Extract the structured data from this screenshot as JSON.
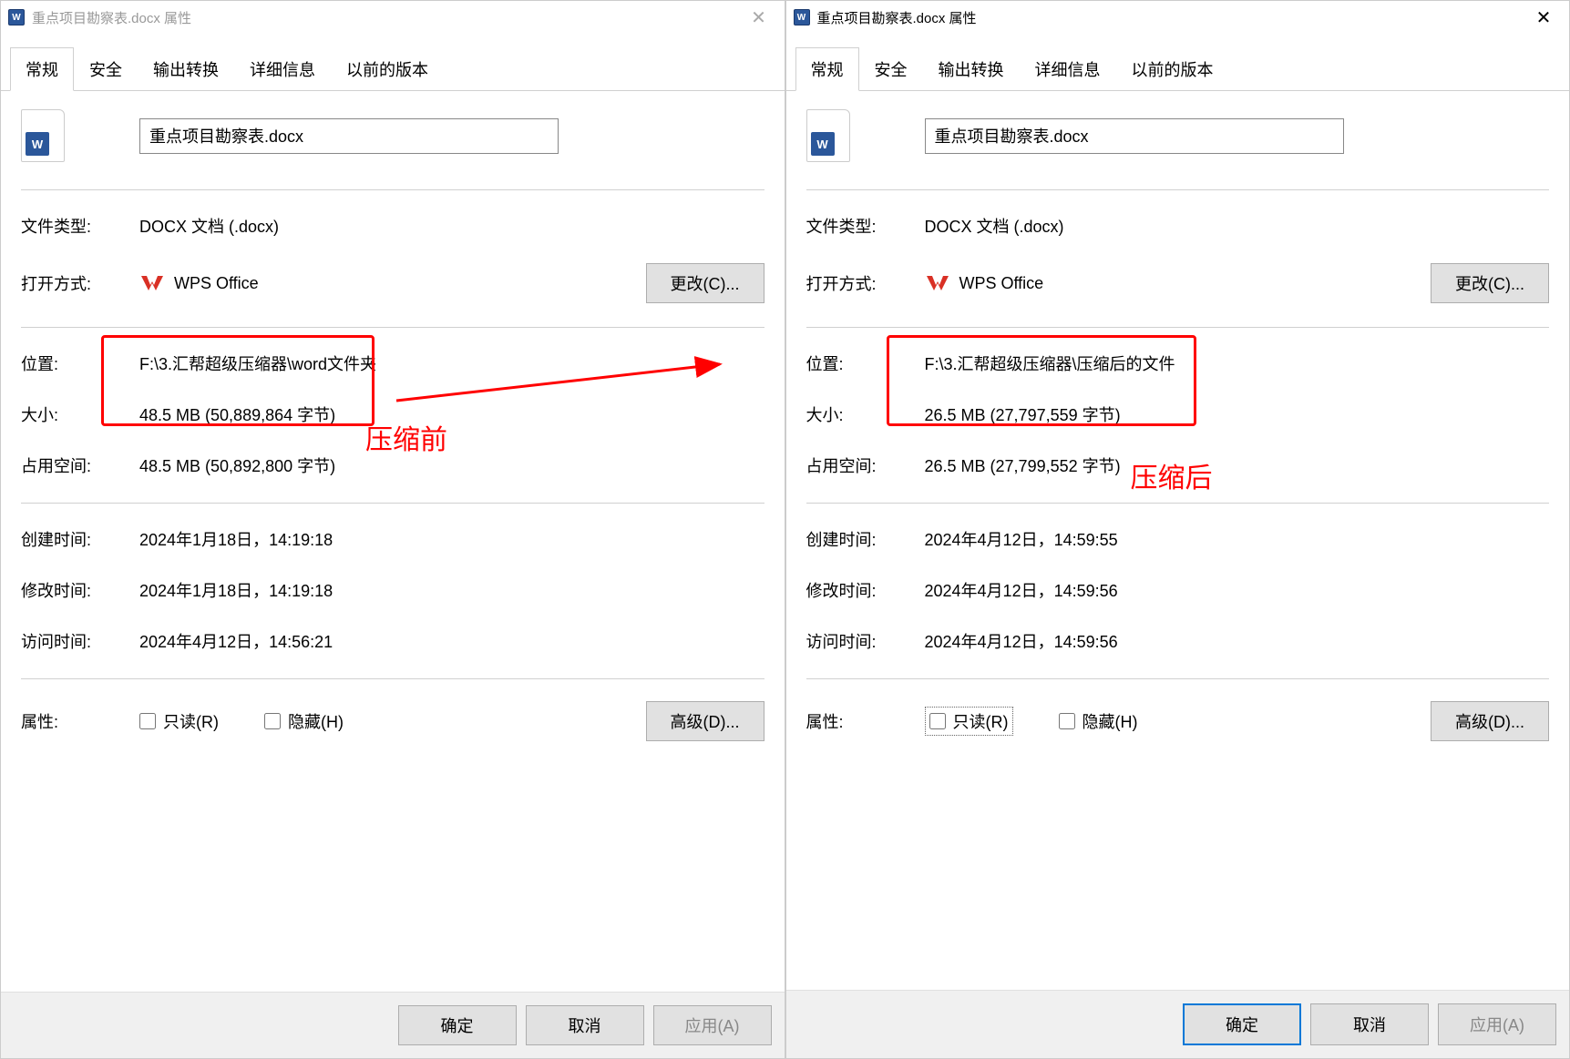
{
  "left": {
    "title": "重点项目勘察表.docx 属性",
    "tabs": [
      "常规",
      "安全",
      "输出转换",
      "详细信息",
      "以前的版本"
    ],
    "active_tab": 0,
    "filename": "重点项目勘察表.docx",
    "labels": {
      "file_type": "文件类型:",
      "open_with": "打开方式:",
      "location": "位置:",
      "size": "大小:",
      "size_on_disk": "占用空间:",
      "created": "创建时间:",
      "modified": "修改时间:",
      "accessed": "访问时间:",
      "attributes": "属性:"
    },
    "values": {
      "file_type": "DOCX 文档 (.docx)",
      "open_with": "WPS Office",
      "location": "F:\\3.汇帮超级压缩器\\word文件夹",
      "size": "48.5 MB (50,889,864 字节)",
      "size_on_disk": "48.5 MB (50,892,800 字节)",
      "created": "2024年1月18日，14:19:18",
      "modified": "2024年1月18日，14:19:18",
      "accessed": "2024年4月12日，14:56:21"
    },
    "buttons": {
      "change": "更改(C)...",
      "advanced": "高级(D)...",
      "ok": "确定",
      "cancel": "取消",
      "apply": "应用(A)"
    },
    "checkboxes": {
      "readonly": "只读(R)",
      "hidden": "隐藏(H)"
    },
    "annotation": "压缩前"
  },
  "right": {
    "title": "重点项目勘察表.docx 属性",
    "tabs": [
      "常规",
      "安全",
      "输出转换",
      "详细信息",
      "以前的版本"
    ],
    "active_tab": 0,
    "filename": "重点项目勘察表.docx",
    "labels": {
      "file_type": "文件类型:",
      "open_with": "打开方式:",
      "location": "位置:",
      "size": "大小:",
      "size_on_disk": "占用空间:",
      "created": "创建时间:",
      "modified": "修改时间:",
      "accessed": "访问时间:",
      "attributes": "属性:"
    },
    "values": {
      "file_type": "DOCX 文档 (.docx)",
      "open_with": "WPS Office",
      "location": "F:\\3.汇帮超级压缩器\\压缩后的文件",
      "size": "26.5 MB (27,797,559 字节)",
      "size_on_disk": "26.5 MB (27,799,552 字节)",
      "created": "2024年4月12日，14:59:55",
      "modified": "2024年4月12日，14:59:56",
      "accessed": "2024年4月12日，14:59:56"
    },
    "buttons": {
      "change": "更改(C)...",
      "advanced": "高级(D)...",
      "ok": "确定",
      "cancel": "取消",
      "apply": "应用(A)"
    },
    "checkboxes": {
      "readonly": "只读(R)",
      "hidden": "隐藏(H)"
    },
    "annotation": "压缩后"
  }
}
